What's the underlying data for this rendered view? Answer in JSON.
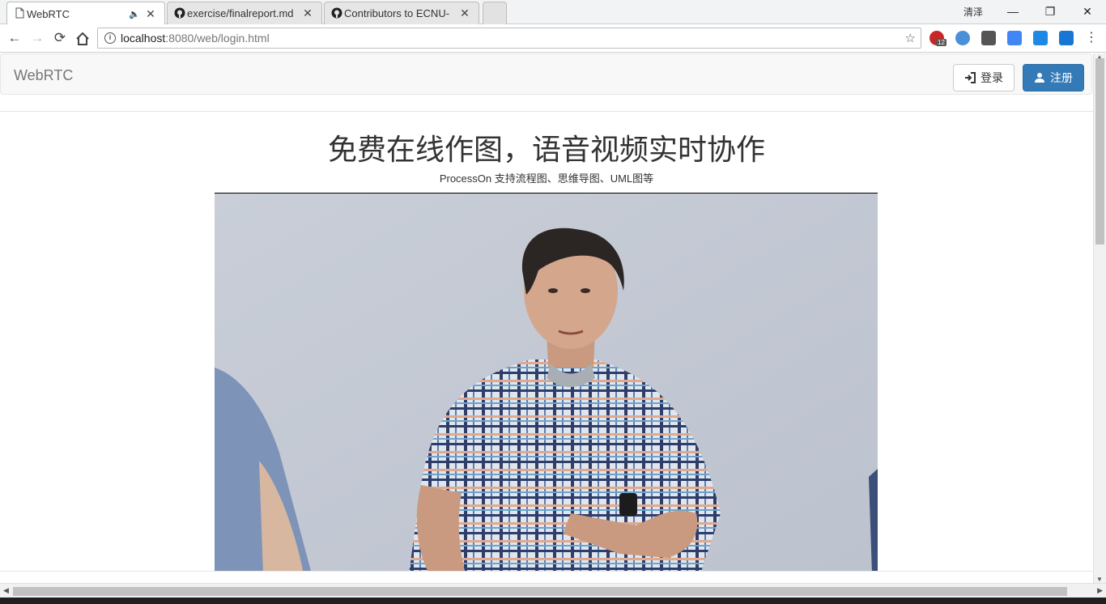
{
  "browser": {
    "tabs": [
      {
        "title": "WebRTC",
        "active": true,
        "icon": "page-icon",
        "audio": true
      },
      {
        "title": "exercise/finalreport.md",
        "active": false,
        "icon": "github-icon"
      },
      {
        "title": "Contributors to ECNU-",
        "active": false,
        "icon": "github-icon"
      }
    ],
    "profile_label": "清泽",
    "window_controls": {
      "minimize": "—",
      "restore": "❐",
      "close": "✕"
    },
    "url": {
      "host": "localhost",
      "rest": ":8080/web/login.html"
    },
    "extensions": [
      {
        "name": "adblock-icon",
        "badge": "12",
        "color": "#c62828"
      },
      {
        "name": "extension-v-icon",
        "color": "#4a90d9"
      },
      {
        "name": "extension-shield-icon",
        "color": "#555555"
      },
      {
        "name": "translate-icon",
        "color": "#4285f4"
      },
      {
        "name": "extension-pen-icon",
        "color": "#1e88e5"
      },
      {
        "name": "extension-app-icon",
        "color": "#1976d2"
      }
    ]
  },
  "page": {
    "navbar": {
      "brand": "WebRTC",
      "login_label": "登录",
      "register_label": "注册"
    },
    "hero": {
      "title": "免费在线作图，语音视频实时协作",
      "subtitle": "ProcessOn 支持流程图、思维导图、UML图等"
    }
  },
  "colors": {
    "primary": "#337ab7",
    "navbar_bg": "#f8f8f8"
  }
}
